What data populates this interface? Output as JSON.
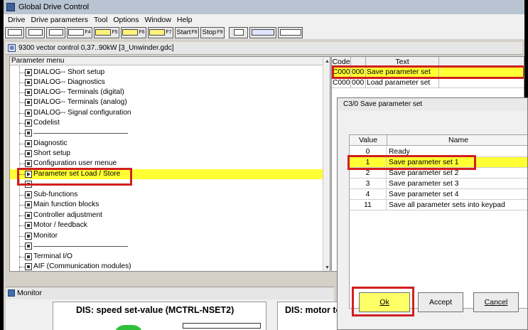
{
  "app": {
    "title": "Global Drive Control"
  },
  "menu": [
    "Drive",
    "Drive parameters",
    "Tool",
    "Options",
    "Window",
    "Help"
  ],
  "toolbar": {
    "f_keys": [
      "F4",
      "F5",
      "F6",
      "F7"
    ],
    "start_label": "Start",
    "start_key": "F8",
    "stop_label": "Stop",
    "stop_key": "F9"
  },
  "document": {
    "title": "9300 vector control 0,37..90kW [3_Unwinder.gdc]"
  },
  "param_menu": {
    "header": "Parameter menu",
    "items": [
      {
        "label": "DIALOG-- Short setup"
      },
      {
        "label": "DIALOG-- Diagnostics"
      },
      {
        "label": "DIALOG-- Terminals (digital)"
      },
      {
        "label": "DIALOG-- Terminals (analog)"
      },
      {
        "label": "DIALOG-- Signal configuration"
      },
      {
        "label": "Codelist"
      },
      {
        "label": ""
      },
      {
        "label": "Diagnostic"
      },
      {
        "label": "Short setup"
      },
      {
        "label": "Configuration user menue"
      },
      {
        "label": "Parameter set Load / Store"
      },
      {
        "label": ""
      },
      {
        "label": "Sub-functions"
      },
      {
        "label": "Main function blocks"
      },
      {
        "label": "Controller adjustment"
      },
      {
        "label": "Motor / feedback"
      },
      {
        "label": "Monitor"
      },
      {
        "label": ""
      },
      {
        "label": "Terminal I/O"
      },
      {
        "label": "AIF (Communication modules)"
      }
    ]
  },
  "code_table": {
    "headers": [
      "Code",
      "",
      "Text"
    ],
    "rows": [
      {
        "code": "C0003",
        "sub": "000",
        "text": "Save parameter set"
      },
      {
        "code": "C0002",
        "sub": "000",
        "text": "Load parameter set"
      }
    ]
  },
  "dialog": {
    "title": "C3/0 Save parameter set",
    "headers": [
      "Value",
      "Name"
    ],
    "rows": [
      {
        "value": "0",
        "name": "Ready"
      },
      {
        "value": "1",
        "name": "Save parameter set 1"
      },
      {
        "value": "2",
        "name": "Save parameter set 2"
      },
      {
        "value": "3",
        "name": "Save parameter set 3"
      },
      {
        "value": "4",
        "name": "Save parameter set 4"
      },
      {
        "value": "11",
        "name": "Save all parameter sets into keypad"
      }
    ],
    "ok_label": "Ok",
    "accept_label": "Accept",
    "cancel_label": "Cancel"
  },
  "monitor": {
    "title": "Monitor",
    "panels": [
      {
        "label": "DIS: speed set-value (MCTRL-NSET2)"
      },
      {
        "label": "DIS: motor to"
      }
    ]
  },
  "colors": {
    "highlight": "#ffff33",
    "annotation": "#d21f1f",
    "ok_button": "#ffff66"
  }
}
